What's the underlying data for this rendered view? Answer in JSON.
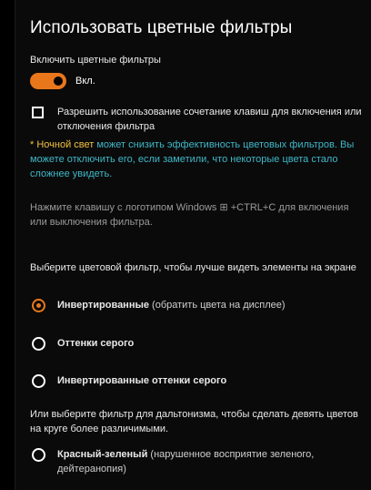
{
  "title": "Использовать цветные фильтры",
  "enable_label": "Включить цветные фильтры",
  "toggle": {
    "state_label": "Вкл.",
    "on": true
  },
  "shortcut_checkbox": {
    "label": "Разрешить использование сочетание клавиш для включения или отключения фильтра",
    "checked": false
  },
  "night_light": {
    "prefix": "* ",
    "link": "Ночной свет",
    "text": " может снизить эффективность цветовых фильтров. Вы можете отключить его, если заметили, что некоторые цвета стало сложнее увидеть."
  },
  "hint": "Нажмите клавишу с логотипом Windows ⊞ +CTRL+C для включения или выключения фильтра.",
  "filter_question": "Выберите цветовой фильтр, чтобы лучше видеть элементы на экране",
  "filters": [
    {
      "name": "Инвертированные",
      "desc": " (обратить цвета на дисплее)",
      "selected": true
    },
    {
      "name": "Оттенки серого",
      "desc": "",
      "selected": false
    },
    {
      "name": "Инвертированные оттенки серого",
      "desc": "",
      "selected": false
    }
  ],
  "colorblind_question": "Или выберите фильтр для дальтонизма, чтобы сделать девять цветов на круге более различимыми.",
  "colorblind_filters": [
    {
      "name": "Красный-зеленый",
      "desc": " (нарушенное восприятие зеленого, дейтеранопия)",
      "selected": false
    }
  ],
  "colors": {
    "accent": "#e8771c",
    "link": "#3fb8c8",
    "highlight": "#f0c040"
  }
}
